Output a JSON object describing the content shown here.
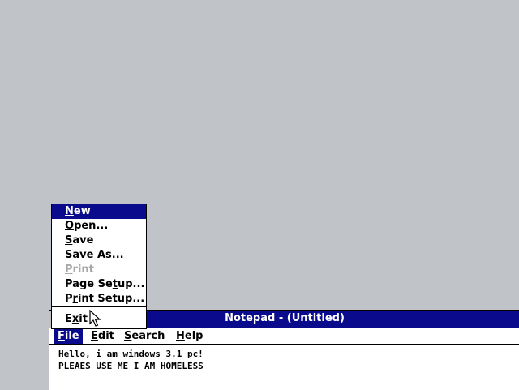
{
  "notepad": {
    "title": "Notepad - (Untitled)",
    "menubar": {
      "file": {
        "pre": "",
        "u": "F",
        "post": "ile"
      },
      "edit": {
        "pre": "",
        "u": "E",
        "post": "dit"
      },
      "search": {
        "pre": "",
        "u": "S",
        "post": "earch"
      },
      "help": {
        "pre": "",
        "u": "H",
        "post": "elp"
      }
    },
    "content_lines": [
      "Hello, i am windows 3.1 pc!",
      "PLEAES USE ME I AM HOMELESS"
    ]
  },
  "file_menu": {
    "items": [
      {
        "pre": "",
        "u": "N",
        "post": "ew",
        "state": "selected"
      },
      {
        "pre": "",
        "u": "O",
        "post": "pen...",
        "state": "normal"
      },
      {
        "pre": "",
        "u": "S",
        "post": "ave",
        "state": "normal"
      },
      {
        "pre": "Save ",
        "u": "A",
        "post": "s...",
        "state": "normal"
      },
      {
        "pre": "",
        "u": "P",
        "post": "rint",
        "state": "disabled"
      },
      {
        "pre": "Page Se",
        "u": "t",
        "post": "up...",
        "state": "normal"
      },
      {
        "pre": "P",
        "u": "r",
        "post": "int Setup...",
        "state": "normal"
      },
      {
        "pre": "E",
        "u": "x",
        "post": "it",
        "state": "normal"
      }
    ]
  },
  "colors": {
    "desktop": "#c0c4c8",
    "highlight": "#0a0a8c",
    "disabled_text": "#a8a8a8"
  },
  "icons": {
    "system_menu": "system-menu-icon",
    "cursor": "arrow-cursor-icon"
  }
}
